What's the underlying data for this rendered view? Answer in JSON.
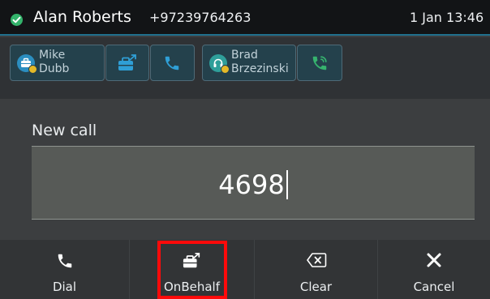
{
  "status_bar": {
    "user_name": "Alan Roberts",
    "user_number": "+97239764263",
    "date_time": "1 Jan 13:46",
    "status_color": "#33b36b",
    "status_icon": "check-icon"
  },
  "blf_keys": [
    {
      "first": "Mike",
      "last": "Dubb",
      "presence": "away",
      "avatar_icon": "briefcase-icon"
    },
    {
      "first": "Brad",
      "last": "Brzezinski",
      "presence": "away",
      "avatar_icon": "headset-icon"
    }
  ],
  "blf_actions": [
    {
      "name": "transfer-on-behalf",
      "icon": "briefcase-arrow-icon"
    },
    {
      "name": "call-mike",
      "icon": "phone-icon",
      "color": "#2f9fd6"
    },
    {
      "name": "call-brad",
      "icon": "phone-ringing-icon",
      "color": "#36b36e"
    }
  ],
  "screen": {
    "title": "New call",
    "dial_input": "4698"
  },
  "softkeys": [
    {
      "label": "Dial",
      "icon": "phone-icon"
    },
    {
      "label": "OnBehalf",
      "icon": "briefcase-arrow-icon",
      "highlighted": true
    },
    {
      "label": "Clear",
      "icon": "backspace-icon"
    },
    {
      "label": "Cancel",
      "icon": "close-icon"
    }
  ],
  "colors": {
    "accent": "#20708d",
    "highlight": "#ff0a0a",
    "background": "#3d3f41"
  }
}
